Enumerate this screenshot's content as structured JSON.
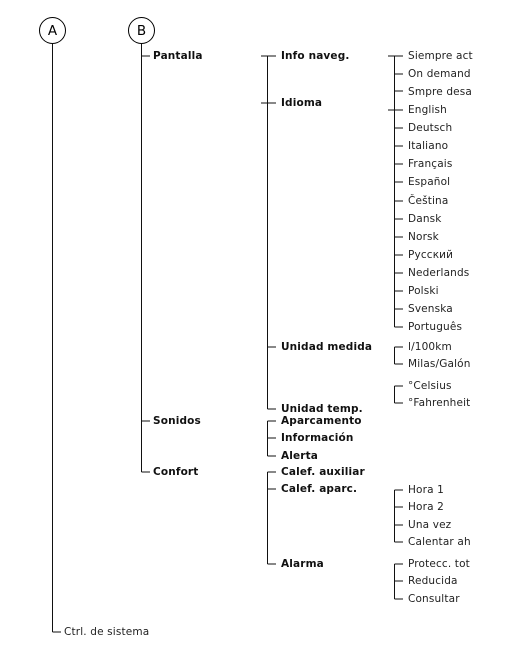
{
  "diagram": {
    "type": "menu-tree",
    "title": "",
    "columns": [
      {
        "id": "A",
        "badge": "A"
      },
      {
        "id": "B",
        "badge": "B"
      }
    ],
    "root_note": "Ctrl. de sistema",
    "nodes": {
      "pantalla": "Pantalla",
      "sonidos": "Sonidos",
      "confort": "Confort",
      "info_naveg": "Info naveg.",
      "idioma": "Idioma",
      "unidad_medida": "Unidad medida",
      "unidad_temp": "Unidad temp.",
      "calef_auxiliar": "Calef. auxiliar",
      "calef_aparc": "Calef. aparc.",
      "alarma": "Alarma"
    },
    "info_naveg_options": [
      "Siempre act",
      "On demand",
      "Smpre desa"
    ],
    "idioma_options": [
      "English",
      "Deutsch",
      "Italiano",
      "Français",
      "Español",
      "Čeština",
      "Dansk",
      "Norsk",
      "Русский",
      "Nederlands",
      "Polski",
      "Svenska",
      "Português"
    ],
    "unidad_medida_options": [
      "l/100km",
      "Milas/Galón"
    ],
    "unidad_temp_options": [
      "°Celsius",
      "°Fahrenheit"
    ],
    "sonidos_options": [
      "Aparcamento",
      "Información",
      "Alerta"
    ],
    "calef_aparc_options": [
      "Hora 1",
      "Hora 2",
      "Una vez",
      "Calentar ah"
    ],
    "alarma_options": [
      "Protecc. tot",
      "Reducida",
      "Consultar"
    ],
    "colors": {
      "line": "#111111",
      "text": "#1a1a1a",
      "background": "#ffffff"
    }
  }
}
